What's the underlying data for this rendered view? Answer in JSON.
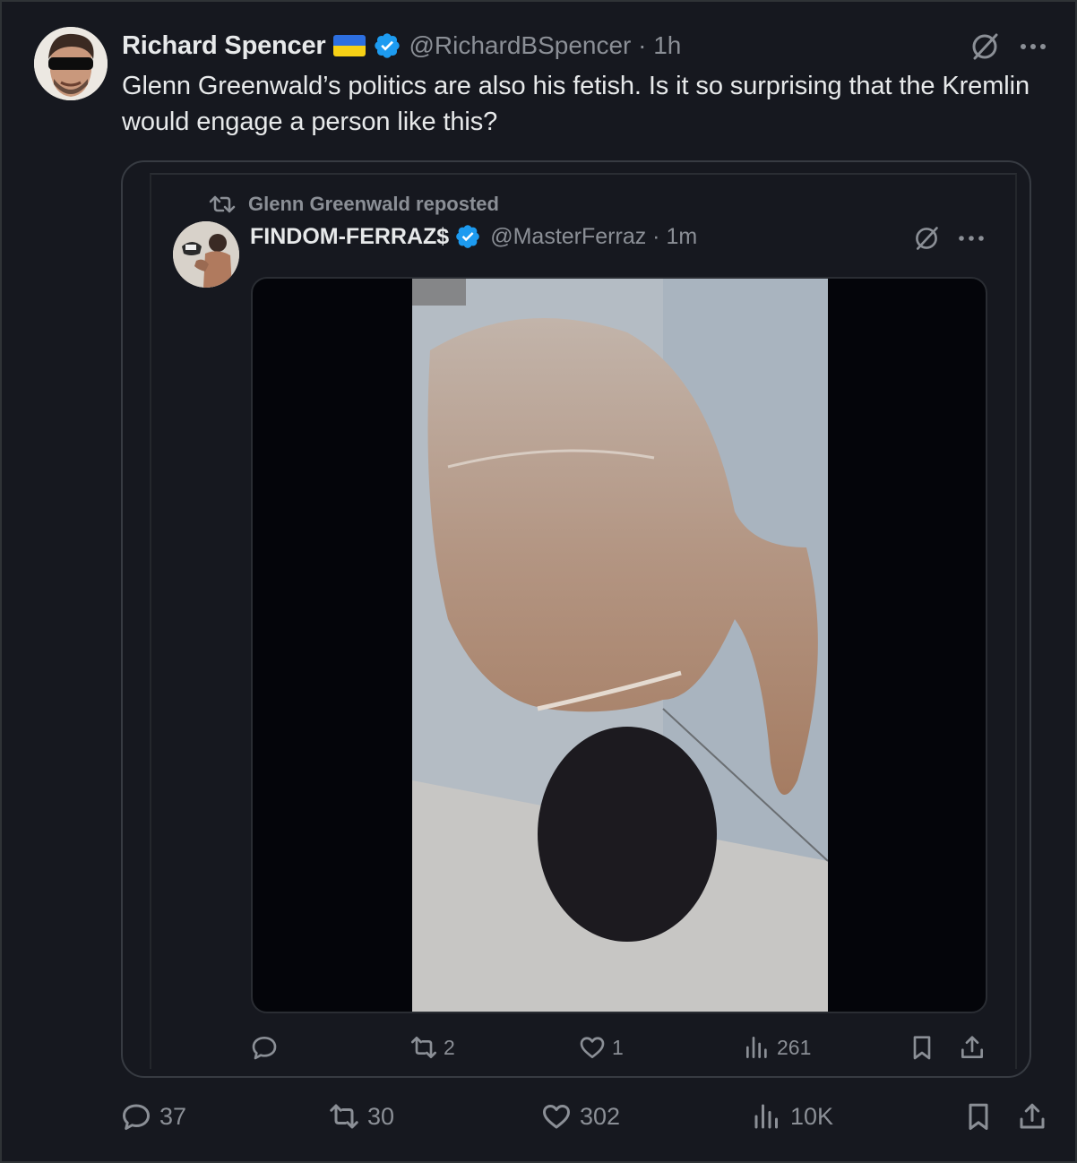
{
  "tweet": {
    "display_name": "Richard Spencer",
    "handle_time": "@RichardBSpencer · 1h",
    "text": "Glenn Greenwald’s politics are also his fetish. Is it so surprising that the Kremlin would engage a person like this?",
    "flag_icon": "ukraine-flag-icon",
    "colors": {
      "verified": "#1d9bf0",
      "flag_blue": "#2d6fe0",
      "flag_yellow": "#f7d116"
    }
  },
  "quoted": {
    "repost_label": "Glenn Greenwald reposted",
    "display_name": "FINDOM-FERRAZ$",
    "handle_time": "@MasterFerraz · 1m",
    "media": "video",
    "actions": {
      "reply": "",
      "reposts": "2",
      "likes": "1",
      "views": "261"
    }
  },
  "actions": {
    "reply": "37",
    "reposts": "30",
    "likes": "302",
    "views": "10K"
  }
}
